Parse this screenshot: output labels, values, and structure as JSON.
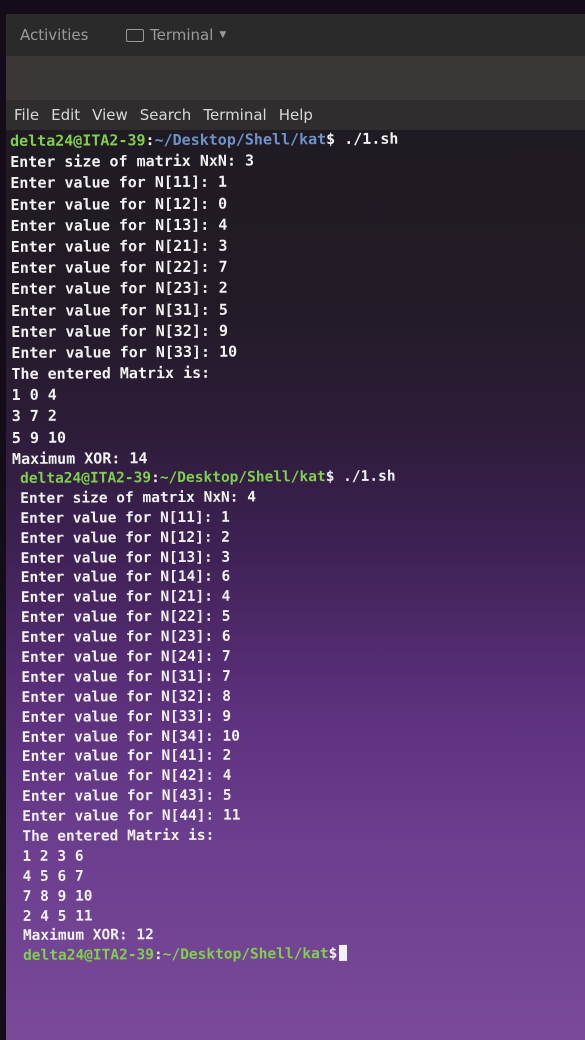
{
  "topbar": {
    "activities": "Activities",
    "app_name": "Terminal"
  },
  "menu": [
    "File",
    "Edit",
    "View",
    "Search",
    "Terminal",
    "Help"
  ],
  "prompt": {
    "user_host": "delta24@ITA2-39",
    "separator": ":",
    "path": "~/Desktop/Shell/kat",
    "symbol": "$"
  },
  "session1": {
    "command": " ./1.sh",
    "lines": [
      "Enter size of matrix NxN: 3",
      "Enter value for N[11]: 1",
      "Enter value for N[12]: 0",
      "Enter value for N[13]: 4",
      "Enter value for N[21]: 3",
      "Enter value for N[22]: 7",
      "Enter value for N[23]: 2",
      "Enter value for N[31]: 5",
      "Enter value for N[32]: 9",
      "Enter value for N[33]: 10",
      "The entered Matrix is:",
      "1 0 4",
      "3 7 2",
      "5 9 10",
      "Maximum XOR: 14"
    ]
  },
  "session2": {
    "command": " ./1.sh",
    "lines": [
      "Enter size of matrix NxN: 4",
      "Enter value for N[11]: 1",
      "Enter value for N[12]: 2",
      "Enter value for N[13]: 3",
      "Enter value for N[14]: 6",
      "Enter value for N[21]: 4",
      "Enter value for N[22]: 5",
      "Enter value for N[23]: 6",
      "Enter value for N[24]: 7",
      "Enter value for N[31]: 7",
      "Enter value for N[32]: 8",
      "Enter value for N[33]: 9",
      "Enter value for N[34]: 10",
      "Enter value for N[41]: 2",
      "Enter value for N[42]: 4",
      "Enter value for N[43]: 5",
      "Enter value for N[44]: 11",
      "The entered Matrix is:",
      "1 2 3 6",
      "4 5 6 7",
      "7 8 9 10",
      "2 4 5 11",
      "Maximum XOR: 12"
    ]
  }
}
